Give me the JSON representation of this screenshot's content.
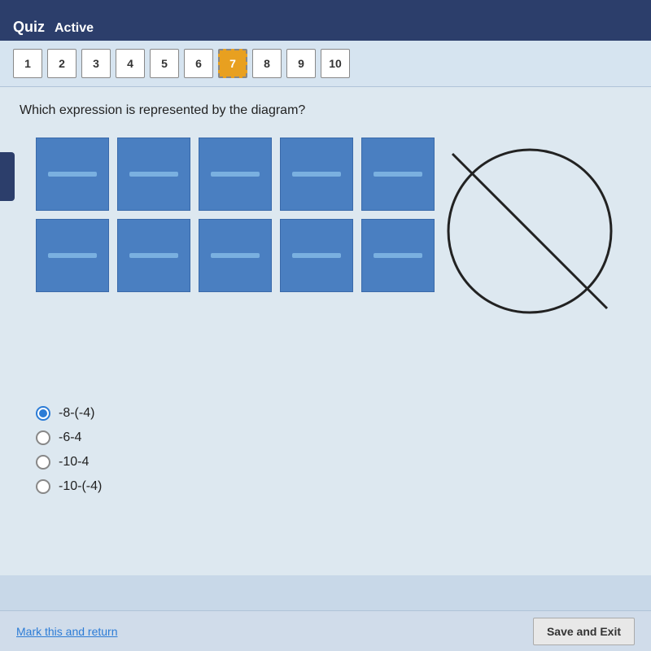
{
  "header": {
    "title": "Quiz",
    "status": "Active"
  },
  "navigation": {
    "buttons": [
      {
        "label": "1",
        "active": false
      },
      {
        "label": "2",
        "active": false
      },
      {
        "label": "3",
        "active": false
      },
      {
        "label": "4",
        "active": false
      },
      {
        "label": "5",
        "active": false
      },
      {
        "label": "6",
        "active": false
      },
      {
        "label": "7",
        "active": true
      },
      {
        "label": "8",
        "active": false
      },
      {
        "label": "9",
        "active": false
      },
      {
        "label": "10",
        "active": false
      }
    ]
  },
  "question": {
    "text": "Which expression is represented by the diagram?"
  },
  "answers": [
    {
      "label": "-8-(-4)",
      "selected": true
    },
    {
      "label": "-6-4",
      "selected": false
    },
    {
      "label": "-10-4",
      "selected": false
    },
    {
      "label": "-10-(-4)",
      "selected": false
    }
  ],
  "footer": {
    "mark_return": "Mark this and return",
    "save_exit": "Save and Exit"
  }
}
